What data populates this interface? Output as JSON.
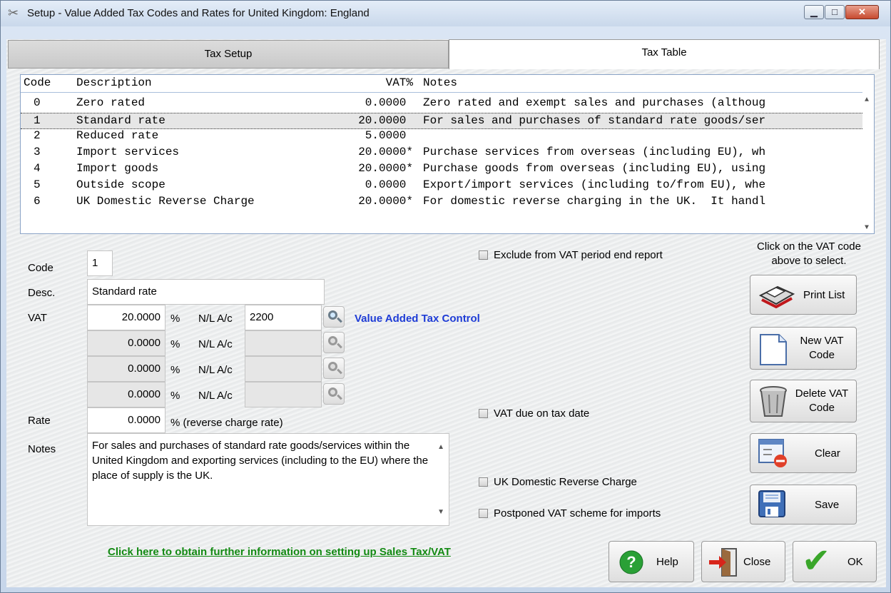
{
  "window": {
    "title": "Setup  -  Value Added Tax Codes and Rates for United Kingdom: England",
    "minimize_glyph": "▁",
    "maximize_glyph": "□",
    "close_glyph": "✕"
  },
  "tabs": {
    "tax_setup": "Tax Setup",
    "tax_table": "Tax Table"
  },
  "table": {
    "headers": {
      "code": "Code",
      "description": "Description",
      "vat": "VAT%",
      "notes": "Notes"
    },
    "rows": [
      {
        "code": "0",
        "description": "Zero rated",
        "vat": "0.0000 ",
        "notes": "Zero rated and exempt sales and purchases (althoug"
      },
      {
        "code": "1",
        "description": "Standard rate",
        "vat": "20.0000 ",
        "notes": "For sales and purchases of standard rate goods/ser"
      },
      {
        "code": "2",
        "description": "Reduced rate",
        "vat": "5.0000 ",
        "notes": ""
      },
      {
        "code": "3",
        "description": "Import services",
        "vat": "20.0000*",
        "notes": "Purchase services from overseas (including EU), wh"
      },
      {
        "code": "4",
        "description": "Import goods",
        "vat": "20.0000*",
        "notes": "Purchase goods from overseas (including EU), using"
      },
      {
        "code": "5",
        "description": "Outside scope",
        "vat": "0.0000 ",
        "notes": "Export/import services (including to/from EU), whe"
      },
      {
        "code": "6",
        "description": "UK Domestic Reverse Charge",
        "vat": "20.0000*",
        "notes": "For domestic reverse charging in the UK.  It handl"
      }
    ],
    "scroll_up": "▲",
    "scroll_down": "▼"
  },
  "form": {
    "code_label": "Code",
    "code_value": "1",
    "desc_label": "Desc.",
    "desc_value": "Standard rate",
    "vat_label": "VAT",
    "vat_lines": [
      {
        "rate": "20.0000",
        "pct": "%",
        "nl_label": "N/L A/c",
        "account": "2200"
      },
      {
        "rate": "0.0000",
        "pct": "%",
        "nl_label": "N/L A/c",
        "account": ""
      },
      {
        "rate": "0.0000",
        "pct": "%",
        "nl_label": "N/L A/c",
        "account": ""
      },
      {
        "rate": "0.0000",
        "pct": "%",
        "nl_label": "N/L A/c",
        "account": ""
      }
    ],
    "account_name": "Value Added Tax Control",
    "rate_label": "Rate",
    "rate_value": "0.0000",
    "rate_suffix": "% (reverse charge rate)",
    "notes_label": "Notes",
    "notes_value": "For sales and purchases of standard rate goods/services within the United Kingdom and exporting services (including to the EU) where the place of supply is the UK.",
    "checkboxes": {
      "exclude_report": "Exclude from VAT period end report",
      "vat_due_tax_date": "VAT due on tax date",
      "uk_domestic_reverse": "UK Domestic Reverse Charge",
      "postponed_vat": "Postponed VAT scheme for imports"
    }
  },
  "side": {
    "hint": "Click on the VAT code above to select.",
    "print_list": "Print List",
    "new_vat_code": "New VAT Code",
    "delete_vat_code": "Delete VAT Code",
    "clear": "Clear",
    "save": "Save"
  },
  "footer": {
    "info_link": "Click here to obtain further information on setting up Sales Tax/VAT",
    "help": "Help",
    "close": "Close",
    "ok": "OK",
    "help_glyph": "?",
    "ok_glyph": "✔"
  }
}
